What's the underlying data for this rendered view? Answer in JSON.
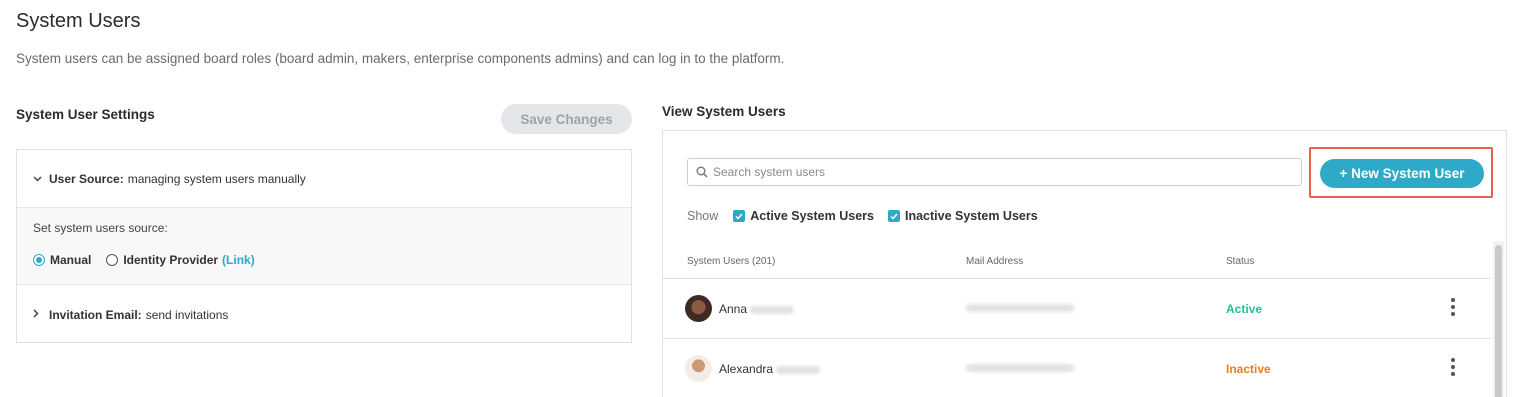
{
  "page": {
    "title": "System Users",
    "description": "System users can be assigned board roles (board admin, makers, enterprise components admins) and can log in to the platform."
  },
  "settings": {
    "heading": "System User Settings",
    "save_label": "Save Changes",
    "user_source": {
      "label": "User Source:",
      "value": "managing system users manually",
      "expanded": true,
      "prompt": "Set system users source:",
      "options": [
        {
          "label": "Manual",
          "selected": true
        },
        {
          "label": "Identity Provider",
          "selected": false,
          "link": "(Link)"
        }
      ]
    },
    "invitation": {
      "label": "Invitation Email:",
      "value": "send invitations",
      "expanded": false
    }
  },
  "users": {
    "heading": "View System Users",
    "search_placeholder": "Search system users",
    "new_button": "+ New System User",
    "show_label": "Show",
    "filters": [
      {
        "label": "Active System Users",
        "checked": true
      },
      {
        "label": "Inactive System Users",
        "checked": true
      }
    ],
    "columns": {
      "name": "System Users (201)",
      "mail": "Mail Address",
      "status": "Status"
    },
    "rows": [
      {
        "first_name": "Anna",
        "status": "Active",
        "status_color": "#1fc0a0",
        "avatar_color": "#5a3d33"
      },
      {
        "first_name": "Alexandra",
        "status": "Inactive",
        "status_color": "#f07c1b",
        "avatar_color": "#b88762"
      }
    ]
  },
  "colors": {
    "accent": "#2fa9c8",
    "highlight_frame": "#e8604c"
  }
}
